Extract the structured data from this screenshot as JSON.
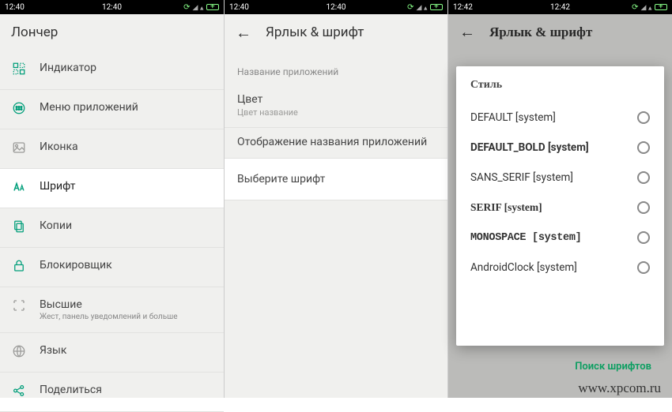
{
  "statusbar": {
    "time_p1": "12:40",
    "time_p2": "12:40",
    "time_p3": "12:42"
  },
  "panel1": {
    "title": "Лончер",
    "items": [
      {
        "label": "Индикатор",
        "sub": ""
      },
      {
        "label": "Меню приложений",
        "sub": ""
      },
      {
        "label": "Иконка",
        "sub": ""
      },
      {
        "label": "Шрифт",
        "sub": ""
      },
      {
        "label": "Копии",
        "sub": ""
      },
      {
        "label": "Блокировщик",
        "sub": ""
      },
      {
        "label": "Высшие",
        "sub": "Жест, панель уведомлений и больше"
      },
      {
        "label": "Язык",
        "sub": ""
      },
      {
        "label": "Поделиться",
        "sub": ""
      }
    ]
  },
  "panel2": {
    "title": "Ярлык & шрифт",
    "section": "Название приложений",
    "item_color_label": "Цвет",
    "item_color_sub": "Цвет название",
    "item_display_label": "Отображение названия приложений",
    "item_font_label": "Выберите шрифт"
  },
  "panel3": {
    "title": "Ярлык & шрифт",
    "dialog_title": "Стиль",
    "options": [
      "DEFAULT [system]",
      "DEFAULT_BOLD [system]",
      "SANS_SERIF [system]",
      "SERIF [system]",
      "MONOSPACE [system]",
      "AndroidClock  [system]"
    ],
    "search": "Поиск шрифтов"
  },
  "watermark": "www.xpcom.ru"
}
